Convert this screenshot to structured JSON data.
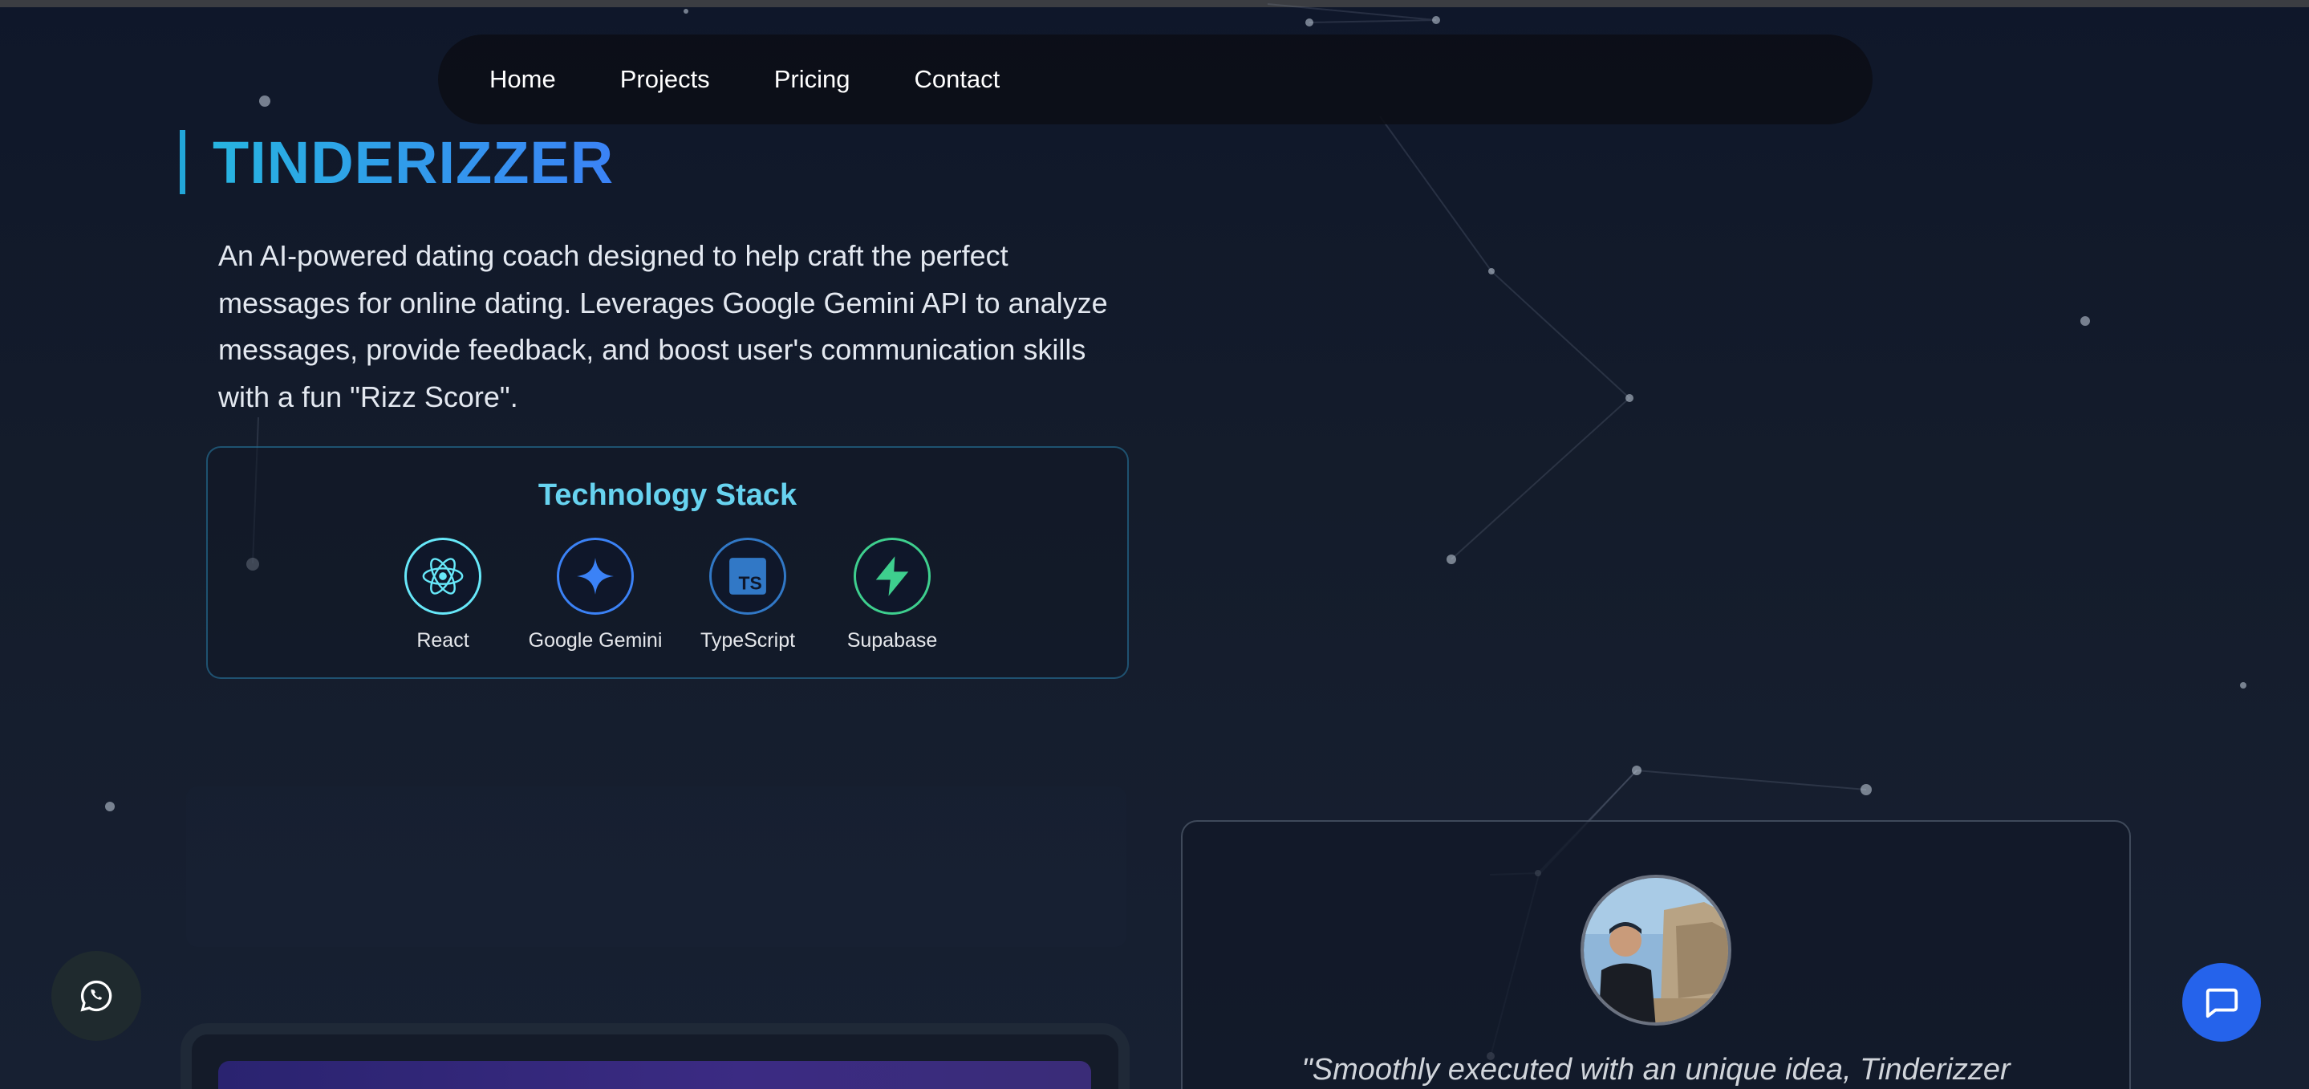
{
  "nav": {
    "items": [
      "Home",
      "Projects",
      "Pricing",
      "Contact"
    ]
  },
  "project": {
    "title": "TINDERIZZER",
    "description": "An AI-powered dating coach designed to help craft the perfect messages for online dating. Leverages Google Gemini API to analyze messages, provide feedback, and boost user's communication skills with a fun \"Rizz Score\"."
  },
  "tech_stack": {
    "title": "Technology Stack",
    "items": [
      {
        "label": "React",
        "icon": "react-icon",
        "color": "#67e8f9"
      },
      {
        "label": "Google Gemini",
        "icon": "sparkle-icon",
        "color": "#3b82f6"
      },
      {
        "label": "TypeScript",
        "icon": "typescript-icon",
        "color": "#3178c6"
      },
      {
        "label": "Supabase",
        "icon": "supabase-bolt-icon",
        "color": "#3ecf8e"
      }
    ]
  },
  "testimonial": {
    "quote": "\"Smoothly executed with an unique idea, Tinderizzer"
  },
  "colors": {
    "accent": "#22a6d8",
    "chat_button": "#2563eb",
    "background": "#111827"
  }
}
